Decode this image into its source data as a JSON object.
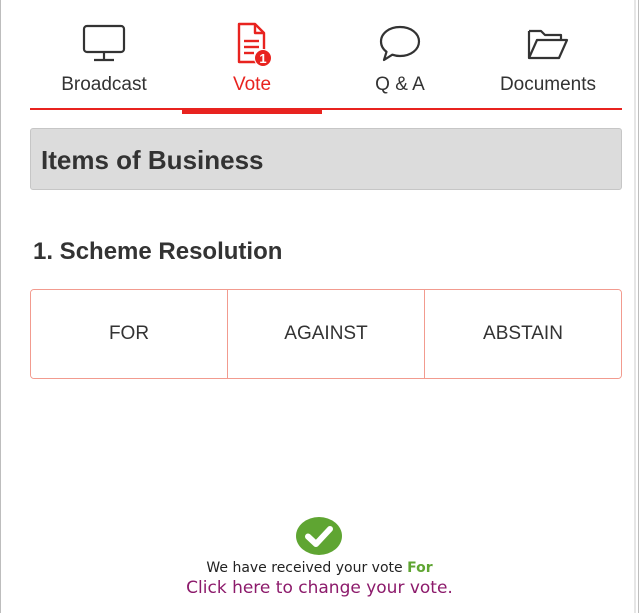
{
  "tabs": [
    {
      "label": "Broadcast",
      "icon": "monitor-icon",
      "active": false
    },
    {
      "label": "Vote",
      "icon": "document-icon",
      "active": true,
      "badge": "1"
    },
    {
      "label": "Q & A",
      "icon": "speech-bubble-icon",
      "active": false
    },
    {
      "label": "Documents",
      "icon": "folder-icon",
      "active": false
    }
  ],
  "section": {
    "title": "Items of Business"
  },
  "resolution": {
    "title": "1. Scheme Resolution",
    "options": [
      "FOR",
      "AGAINST",
      "ABSTAIN"
    ]
  },
  "confirmation": {
    "text": "We have received your vote",
    "choice": "For",
    "change_link": "Click here to change your vote.",
    "icon": "check-circle-icon"
  },
  "colors": {
    "accent": "#e8231f",
    "success": "#5fa532",
    "link": "#8c1a6b",
    "option_border": "#f29b8f"
  }
}
